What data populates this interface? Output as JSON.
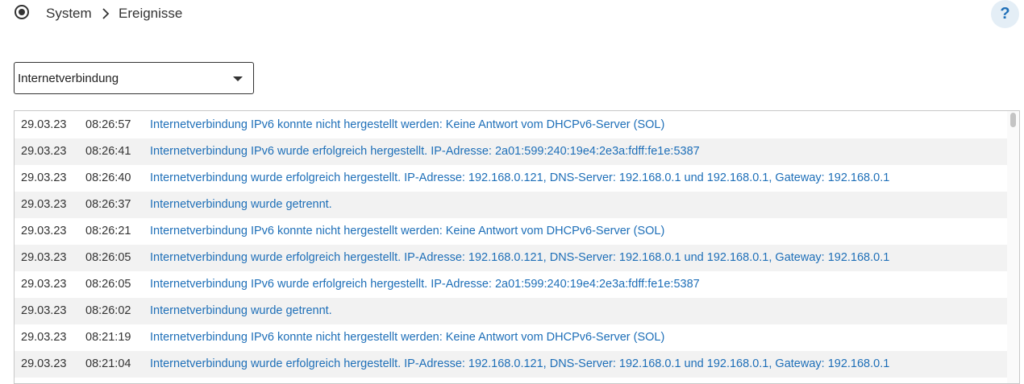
{
  "breadcrumb": {
    "root": "System",
    "current": "Ereignisse"
  },
  "help": {
    "label": "?"
  },
  "filter": {
    "selected": "Internetverbindung"
  },
  "events": [
    {
      "date": "29.03.23",
      "time": "08:26:57",
      "message": "Internetverbindung IPv6 konnte nicht hergestellt werden: Keine Antwort vom DHCPv6-Server (SOL)"
    },
    {
      "date": "29.03.23",
      "time": "08:26:41",
      "message": "Internetverbindung IPv6 wurde erfolgreich hergestellt. IP-Adresse: 2a01:599:240:19e4:2e3a:fdff:fe1e:5387"
    },
    {
      "date": "29.03.23",
      "time": "08:26:40",
      "message": "Internetverbindung wurde erfolgreich hergestellt. IP-Adresse: 192.168.0.121, DNS-Server: 192.168.0.1 und 192.168.0.1, Gateway: 192.168.0.1"
    },
    {
      "date": "29.03.23",
      "time": "08:26:37",
      "message": "Internetverbindung wurde getrennt."
    },
    {
      "date": "29.03.23",
      "time": "08:26:21",
      "message": "Internetverbindung IPv6 konnte nicht hergestellt werden: Keine Antwort vom DHCPv6-Server (SOL)"
    },
    {
      "date": "29.03.23",
      "time": "08:26:05",
      "message": "Internetverbindung wurde erfolgreich hergestellt. IP-Adresse: 192.168.0.121, DNS-Server: 192.168.0.1 und 192.168.0.1, Gateway: 192.168.0.1"
    },
    {
      "date": "29.03.23",
      "time": "08:26:05",
      "message": "Internetverbindung IPv6 wurde erfolgreich hergestellt. IP-Adresse: 2a01:599:240:19e4:2e3a:fdff:fe1e:5387"
    },
    {
      "date": "29.03.23",
      "time": "08:26:02",
      "message": "Internetverbindung wurde getrennt."
    },
    {
      "date": "29.03.23",
      "time": "08:21:19",
      "message": "Internetverbindung IPv6 konnte nicht hergestellt werden: Keine Antwort vom DHCPv6-Server (SOL)"
    },
    {
      "date": "29.03.23",
      "time": "08:21:04",
      "message": "Internetverbindung wurde erfolgreich hergestellt. IP-Adresse: 192.168.0.121, DNS-Server: 192.168.0.1 und 192.168.0.1, Gateway: 192.168.0.1"
    }
  ],
  "icons": {
    "status": "radio-dot-icon",
    "separator": "chevron-right-icon",
    "dropdown": "caret-down-icon"
  },
  "colors": {
    "link": "#1e6fb8",
    "help_bg": "#e4eef6",
    "row_alt": "#f2f2f2"
  }
}
